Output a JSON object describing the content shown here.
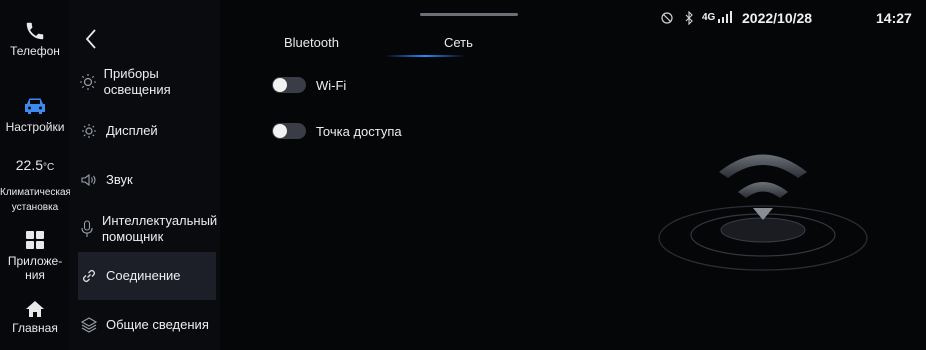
{
  "dock": {
    "phone": "Телефон",
    "settings": "Настройки",
    "temperature": "22.5",
    "temperature_unit": "°C",
    "climate": [
      "Климатическая",
      "установка"
    ],
    "apps": [
      "Приложе-",
      "ния"
    ],
    "home": "Главная"
  },
  "menu": {
    "items": [
      {
        "label": "Приборы освещения",
        "icon": "lightbulb-icon"
      },
      {
        "label": "Дисплей",
        "icon": "brightness-icon"
      },
      {
        "label": "Звук",
        "icon": "speaker-icon"
      },
      {
        "label": [
          "Интеллектуальный",
          "помощник"
        ],
        "icon": "microphone-icon"
      },
      {
        "label": "Соединение",
        "icon": "link-icon",
        "active": true
      },
      {
        "label": "Общие сведения",
        "icon": "layers-icon"
      }
    ]
  },
  "status": {
    "network": "4G",
    "date": "2022/10/28",
    "time": "14:27"
  },
  "tabs": [
    {
      "label": "Bluetooth"
    },
    {
      "label": "Сеть",
      "active": true
    }
  ],
  "settings_rows": [
    {
      "label": "Wi-Fi",
      "enabled": false
    },
    {
      "label": "Точка доступа",
      "enabled": false
    }
  ],
  "colors": {
    "accent": "#2f86ff",
    "car_icon": "#3c8cf0"
  }
}
